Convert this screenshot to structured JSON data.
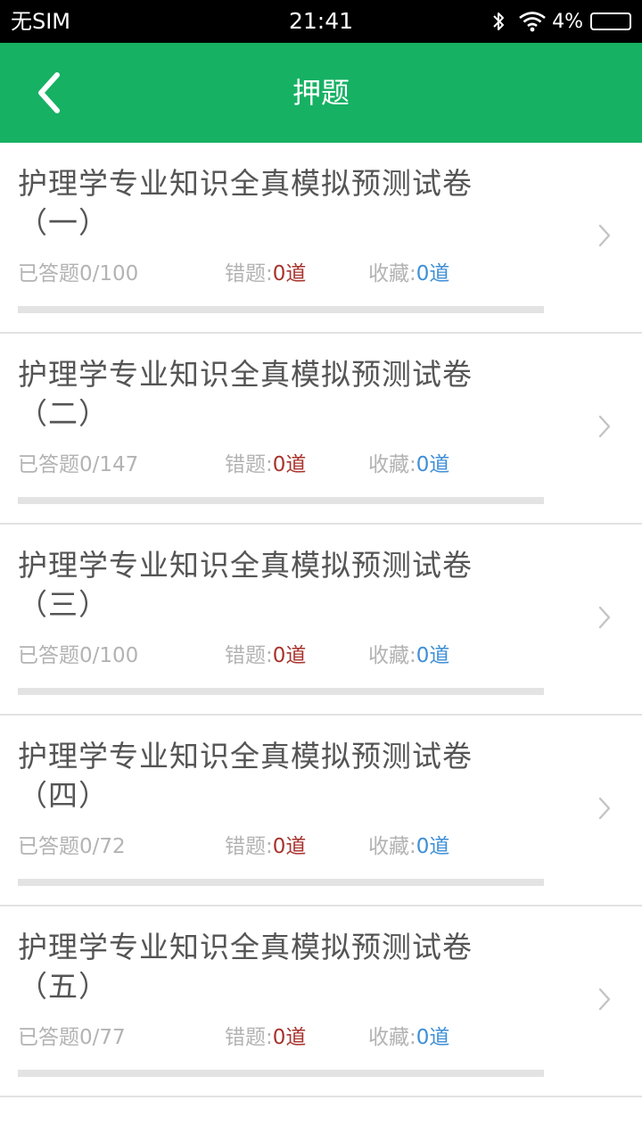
{
  "status_bar": {
    "carrier": "无SIM",
    "time": "21:41",
    "battery_percent": "4%"
  },
  "header": {
    "title": "押题",
    "back_icon": "chevron-left-icon"
  },
  "colors": {
    "brand": "#16b163",
    "wrong_value": "#a8332d",
    "favorite_value": "#3f8fd6"
  },
  "papers": [
    {
      "title": "护理学专业知识全真模拟预测试卷（一）",
      "answered": "已答题0/100",
      "wrong_label": "错题:",
      "wrong_value": "0道",
      "fav_label": "收藏:",
      "fav_value": "0道",
      "progress": 0
    },
    {
      "title": "护理学专业知识全真模拟预测试卷（二）",
      "answered": "已答题0/147",
      "wrong_label": "错题:",
      "wrong_value": "0道",
      "fav_label": "收藏:",
      "fav_value": "0道",
      "progress": 0
    },
    {
      "title": "护理学专业知识全真模拟预测试卷（三）",
      "answered": "已答题0/100",
      "wrong_label": "错题:",
      "wrong_value": "0道",
      "fav_label": "收藏:",
      "fav_value": "0道",
      "progress": 0
    },
    {
      "title": "护理学专业知识全真模拟预测试卷（四）",
      "answered": "已答题0/72",
      "wrong_label": "错题:",
      "wrong_value": "0道",
      "fav_label": "收藏:",
      "fav_value": "0道",
      "progress": 0
    },
    {
      "title": "护理学专业知识全真模拟预测试卷（五）",
      "answered": "已答题0/77",
      "wrong_label": "错题:",
      "wrong_value": "0道",
      "fav_label": "收藏:",
      "fav_value": "0道",
      "progress": 0
    }
  ]
}
